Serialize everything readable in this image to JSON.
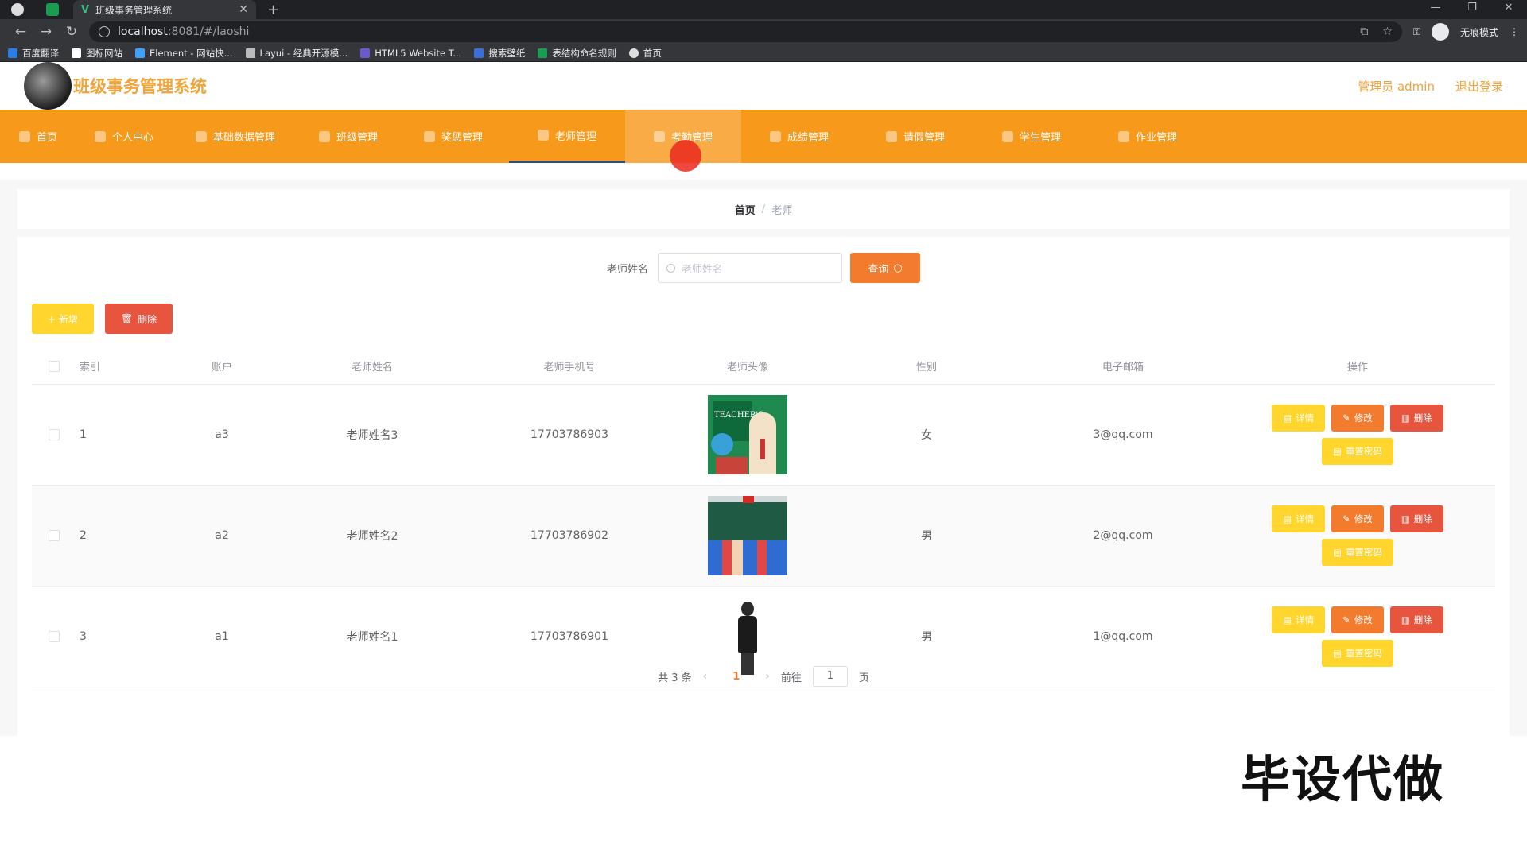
{
  "browser": {
    "tab_title": "班级事务管理系统",
    "url_host": "localhost",
    "url_path": ":8081/#/laoshi",
    "incognito_label": "无痕模式",
    "bookmarks": [
      "百度翻译",
      "图标网站",
      "Element - 网站快...",
      "Layui - 经典开源模...",
      "HTML5 Website T...",
      "搜索壁纸",
      "表结构命名规则",
      "首页"
    ]
  },
  "header": {
    "title": "班级事务管理系统",
    "admin_label": "管理员 admin",
    "logout_label": "退出登录"
  },
  "nav": {
    "items": [
      "首页",
      "个人中心",
      "基础数据管理",
      "班级管理",
      "奖惩管理",
      "老师管理",
      "考勤管理",
      "成绩管理",
      "请假管理",
      "学生管理",
      "作业管理"
    ],
    "active": "老师管理",
    "hover": "考勤管理"
  },
  "breadcrumb": {
    "home": "首页",
    "separator": "/",
    "current": "老师"
  },
  "search": {
    "label": "老师姓名",
    "placeholder": "老师姓名",
    "button": "查询"
  },
  "actions": {
    "add": "+ 新增",
    "delete": "删除"
  },
  "table": {
    "headers": [
      "索引",
      "账户",
      "老师姓名",
      "老师手机号",
      "老师头像",
      "性别",
      "电子邮箱",
      "操作"
    ],
    "rows": [
      {
        "index": "1",
        "account": "a3",
        "name": "老师姓名3",
        "phone": "17703786903",
        "avatar": "teachers-day-illustration",
        "gender": "女",
        "email": "3@qq.com"
      },
      {
        "index": "2",
        "account": "a2",
        "name": "老师姓名2",
        "phone": "17703786902",
        "avatar": "classroom-photo",
        "gender": "男",
        "email": "2@qq.com"
      },
      {
        "index": "3",
        "account": "a1",
        "name": "老师姓名1",
        "phone": "17703786901",
        "avatar": "teacher-standing-photo",
        "gender": "男",
        "email": "1@qq.com"
      }
    ],
    "row_ops": {
      "detail": "详情",
      "edit": "修改",
      "delete": "删除",
      "reset": "重置密码"
    }
  },
  "pagination": {
    "total": "共 3 条",
    "current_page": "1",
    "goto_label": "前往",
    "goto_value": "1",
    "page_suffix": "页"
  },
  "watermark": "毕设代做",
  "colors": {
    "nav_bg": "#f79a1c",
    "title": "#f0a43a",
    "primary_btn": "#f27b2e",
    "warning_btn": "#ffd52e",
    "danger_btn": "#e8553e"
  }
}
